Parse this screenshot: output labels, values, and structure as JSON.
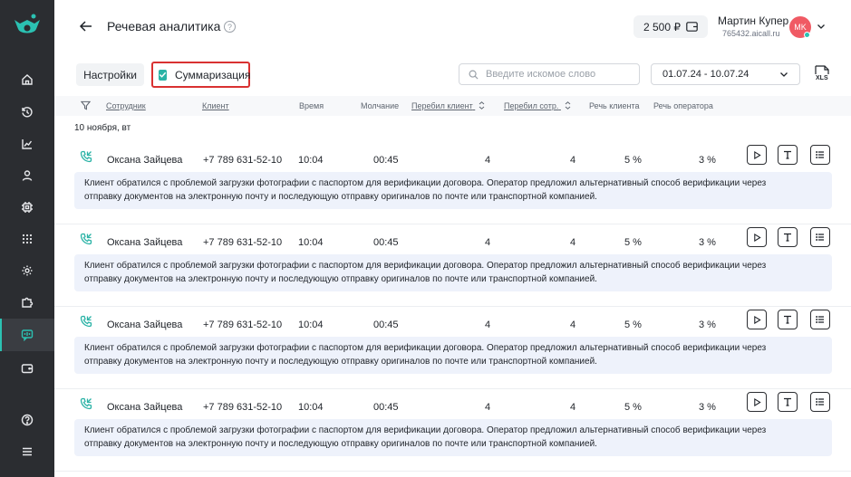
{
  "header": {
    "title": "Речевая аналитика",
    "help": "?",
    "balance": "2 500 ₽",
    "user_name": "Мартин Купер",
    "user_sub": "765432.aicall.ru",
    "avatar_initials": "MK"
  },
  "toolbar": {
    "settings_label": "Настройки",
    "summarization_label": "Суммаризация",
    "summarization_checked": true,
    "search_placeholder": "Введите искомое слово",
    "date_range": "01.07.24 - 10.07.24",
    "export_label": "XLS"
  },
  "table": {
    "columns": {
      "employee": "Сотрудник",
      "client": "Клиент",
      "time": "Время",
      "silence": "Молчание",
      "client_interrupt": "Перебил клиент",
      "operator_interrupt": "Перебил сотр.",
      "client_speech": "Речь клиента",
      "operator_speech": "Речь оператора"
    },
    "group_date": "10 ноября, вт",
    "rows": [
      {
        "employee": "Оксана Зайцева",
        "client": "+7 789 631-52-10",
        "time": "10:04",
        "silence": "00:45",
        "client_interrupt": "4",
        "operator_interrupt": "4",
        "client_speech": "5 %",
        "operator_speech": "3 %",
        "summary_line1": "Клиент обратился с проблемой загрузки фотографии с паспортом для верификации договора. Оператор предложил альтернативный способ верификации через",
        "summary_line2": "отправку документов на электронную почту и последующую отправку оригиналов по почте или транспортной компанией."
      },
      {
        "employee": "Оксана Зайцева",
        "client": "+7 789 631-52-10",
        "time": "10:04",
        "silence": "00:45",
        "client_interrupt": "4",
        "operator_interrupt": "4",
        "client_speech": "5 %",
        "operator_speech": "3 %",
        "summary_line1": "Клиент обратился с проблемой загрузки фотографии с паспортом для верификации договора. Оператор предложил альтернативный способ верификации через",
        "summary_line2": "отправку документов на электронную почту и последующую отправку оригиналов по почте или транспортной компанией."
      },
      {
        "employee": "Оксана Зайцева",
        "client": "+7 789 631-52-10",
        "time": "10:04",
        "silence": "00:45",
        "client_interrupt": "4",
        "operator_interrupt": "4",
        "client_speech": "5 %",
        "operator_speech": "3 %",
        "summary_line1": "Клиент обратился с проблемой загрузки фотографии с паспортом для верификации договора. Оператор предложил альтернативный способ верификации через",
        "summary_line2": "отправку документов на электронную почту и последующую отправку оригиналов по почте или транспортной компанией."
      },
      {
        "employee": "Оксана Зайцева",
        "client": "+7 789 631-52-10",
        "time": "10:04",
        "silence": "00:45",
        "client_interrupt": "4",
        "operator_interrupt": "4",
        "client_speech": "5 %",
        "operator_speech": "3 %",
        "summary_line1": "Клиент обратился с проблемой загрузки фотографии с паспортом для верификации договора. Оператор предложил альтернативный способ верификации через",
        "summary_line2": "отправку документов на электронную почту и последующую отправку оригиналов по почте или транспортной компанией."
      }
    ]
  },
  "colors": {
    "sidebar_bg": "#2b2d31",
    "accent": "#2bc1b2",
    "highlight_border": "#d93131",
    "summary_bg": "#eef2fb",
    "avatar_bg": "#f05a64"
  },
  "sidebar": {
    "items": [
      "home-icon",
      "history-icon",
      "chart-icon",
      "user-icon",
      "chip-icon",
      "grid-icon",
      "gear-icon",
      "puzzle-icon",
      "speech-analytics-icon",
      "wallet-icon",
      "help-icon",
      "menu-icon"
    ],
    "active": "speech-analytics-icon"
  }
}
